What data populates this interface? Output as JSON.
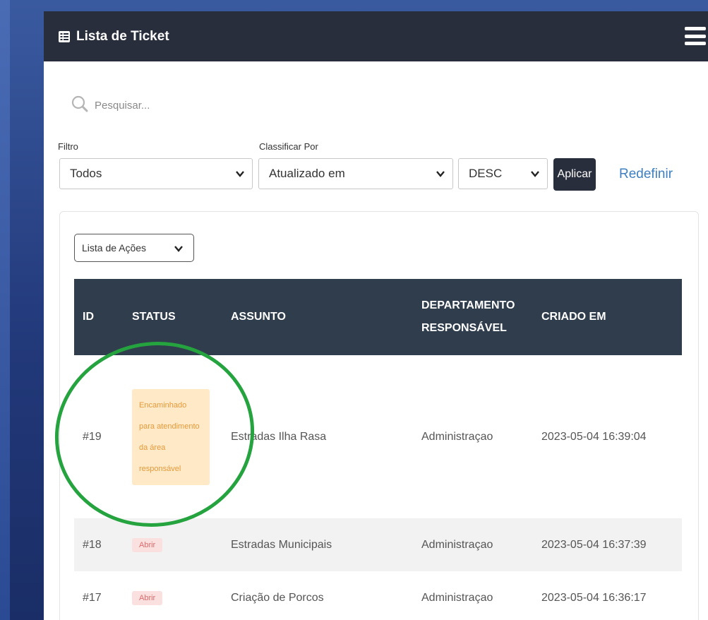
{
  "header": {
    "title": "Lista de Ticket",
    "list_icon": "list-icon",
    "menu_icon": "hamburger-menu-icon"
  },
  "search": {
    "placeholder": "Pesquisar...",
    "icon": "search-icon"
  },
  "filters": {
    "filter_label": "Filtro",
    "filter_value": "Todos",
    "sort_label": "Classificar Por",
    "sort_value": "Atualizado em",
    "order_value": "DESC",
    "apply_label": "Aplicar",
    "reset_label": "Redefinir"
  },
  "actions": {
    "label": "Lista de Ações"
  },
  "table": {
    "columns": [
      "ID",
      "STATUS",
      "ASSUNTO",
      "DEPARTAMENTO RESPONSÁVEL",
      "CRIADO EM"
    ],
    "column_lines": {
      "dept_line1": "DEPARTAMENTO",
      "dept_line2": "RESPONSÁVEL"
    },
    "rows": [
      {
        "id": "#19",
        "status": "Encaminhado para atendimento da área responsável",
        "subject": "Estradas Ilha Rasa",
        "department": "Administraçao",
        "created": "2023-05-04 16:39:04"
      },
      {
        "id": "#18",
        "status": "Abrir",
        "subject": "Estradas Municipais",
        "department": "Administraçao",
        "created": "2023-05-04 16:37:39"
      },
      {
        "id": "#17",
        "status": "Abrir",
        "subject": "Criação de Porcos",
        "department": "Administraçao",
        "created": "2023-05-04 16:36:17"
      }
    ]
  },
  "colors": {
    "header_bg": "#292e3c",
    "table_header_bg": "#2f3d4d",
    "forward_badge_bg": "#ffe9c6",
    "forward_badge_text": "#e49a3b",
    "open_badge_bg": "#fbe0e0",
    "open_badge_text": "#e06b6b",
    "link": "#3d7fc1",
    "annotation_circle": "#25a33f",
    "background": "#22397a"
  }
}
